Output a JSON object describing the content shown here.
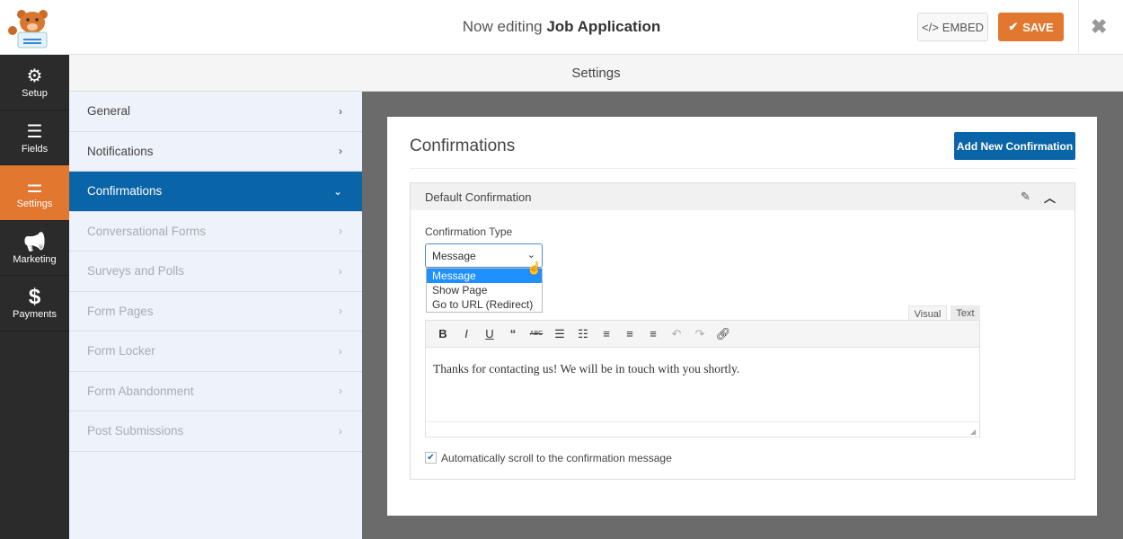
{
  "header": {
    "title_prefix": "Now editing",
    "title_form": "Job Application",
    "embed_label": "EMBED",
    "save_label": "SAVE",
    "embed_icon": "</>",
    "save_icon": "✔",
    "close_icon": "✖"
  },
  "nav": {
    "items": [
      {
        "label": "Setup",
        "icon": "⚙"
      },
      {
        "label": "Fields",
        "icon": "☰"
      },
      {
        "label": "Settings",
        "icon": "⚌"
      },
      {
        "label": "Marketing",
        "icon": "📢"
      },
      {
        "label": "Payments",
        "icon": "$"
      }
    ]
  },
  "settings_bar": {
    "title": "Settings"
  },
  "panel": {
    "items": [
      {
        "label": "General"
      },
      {
        "label": "Notifications"
      },
      {
        "label": "Confirmations"
      },
      {
        "label": "Conversational Forms"
      },
      {
        "label": "Surveys and Polls"
      },
      {
        "label": "Form Pages"
      },
      {
        "label": "Form Locker"
      },
      {
        "label": "Form Abandonment"
      },
      {
        "label": "Post Submissions"
      }
    ]
  },
  "main": {
    "title": "Confirmations",
    "add_button": "Add New Confirmation",
    "box_title": "Default Confirmation",
    "confirmation_type_label": "Confirmation Type",
    "selected": "Message",
    "options": [
      "Message",
      "Show Page",
      "Go to URL (Redirect)"
    ],
    "tab_visual": "Visual",
    "tab_text": "Text",
    "editor_text": "Thanks for contacting us! We will be in touch with you shortly.",
    "autoscroll_label": "Automatically scroll to the confirmation message",
    "autoscroll_checked": true
  },
  "colors": {
    "accent_orange": "#e27730",
    "accent_blue": "#0a64a8"
  }
}
